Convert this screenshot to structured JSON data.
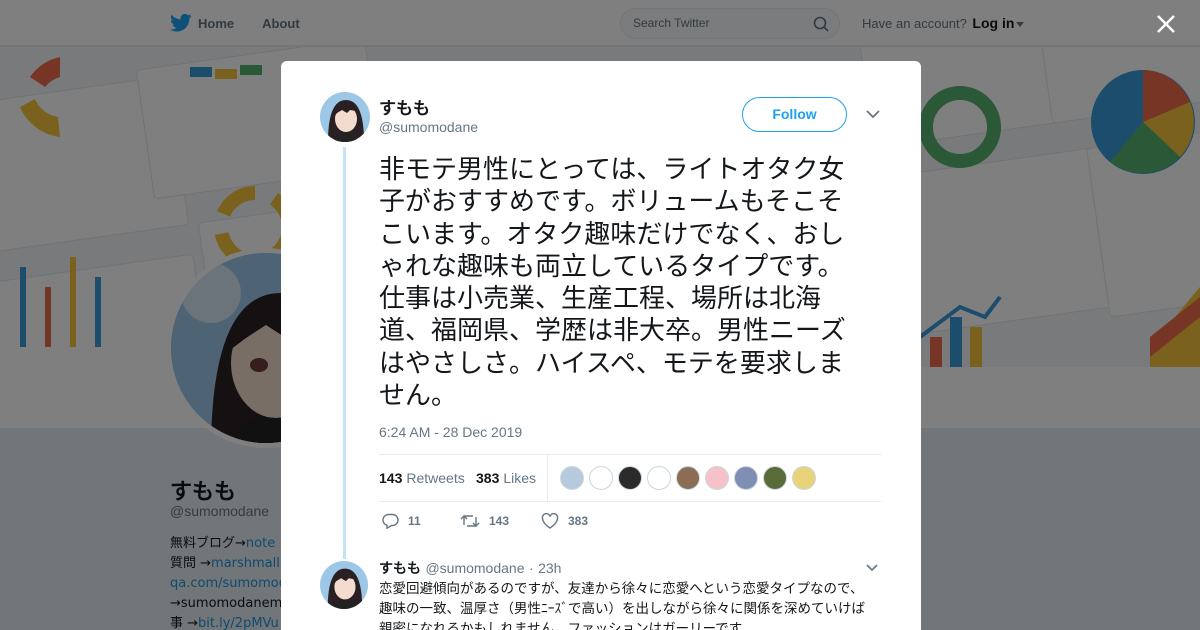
{
  "topbar": {
    "home_label": "Home",
    "about_label": "About",
    "search_placeholder": "Search Twitter",
    "account_prompt": "Have an account?",
    "login_label": "Log in"
  },
  "background_profile": {
    "name": "すもも",
    "handle": "@sumomodane",
    "bio_lines": [
      {
        "text": "無料ブログ→",
        "link": "note"
      },
      {
        "text": "質問 →",
        "link": "marshmall"
      },
      {
        "text": "",
        "link": "qa.com/sumomod"
      },
      {
        "text": "→sumomodanem",
        "link": ""
      },
      {
        "text": "事 →",
        "link": "bit.ly/2pMVu"
      }
    ]
  },
  "tweet": {
    "author_name": "すもも",
    "author_handle": "@sumomodane",
    "follow_label": "Follow",
    "text": "非モテ男性にとっては、ライトオタク女子がおすすめです。ボリュームもそこそこいます。オタク趣味だけでなく、おしゃれな趣味も両立しているタイプです。仕事は小売業、生産工程、場所は北海道、福岡県、学歴は非大卒。男性ニーズはやさしさ。ハイスペ、モテを要求しません。",
    "timestamp": "6:24 AM - 28 Dec 2019",
    "retweets_count": "143",
    "retweets_label": "Retweets",
    "likes_count": "383",
    "likes_label": "Likes",
    "liker_avatars": [
      {
        "icon": "liker-avatar-1",
        "color": "#b7c9dd"
      },
      {
        "icon": "liker-avatar-2",
        "color": "#ffffff"
      },
      {
        "icon": "liker-avatar-3",
        "color": "#2b2b2b"
      },
      {
        "icon": "liker-avatar-4",
        "color": "#ffffff"
      },
      {
        "icon": "liker-avatar-5",
        "color": "#8a6d54"
      },
      {
        "icon": "liker-avatar-6",
        "color": "#f4c2c8"
      },
      {
        "icon": "liker-avatar-7",
        "color": "#7e8fb3"
      },
      {
        "icon": "liker-avatar-8",
        "color": "#5a6b3a"
      },
      {
        "icon": "liker-avatar-9",
        "color": "#e8d27a"
      }
    ],
    "reply_count": "11",
    "retweet_count": "143",
    "like_count": "383"
  },
  "reply": {
    "author_name": "すもも",
    "author_handle": "@sumomodane",
    "separator": "·",
    "age": "23h",
    "text": "恋愛回避傾向があるのですが、友達から徐々に恋愛へという恋愛タイプなので、趣味の一致、温厚さ（男性ﾆｰｽﾞで高い）を出しながら徐々に関係を深めていけば親密になれるかもしれません。ファッションはガーリーです。"
  },
  "colors": {
    "twitter_blue": "#1da1f2",
    "link_blue": "#1b95e0",
    "text_dark": "#14171a",
    "text_muted": "#657786",
    "thread_line": "#c4e3f7"
  }
}
